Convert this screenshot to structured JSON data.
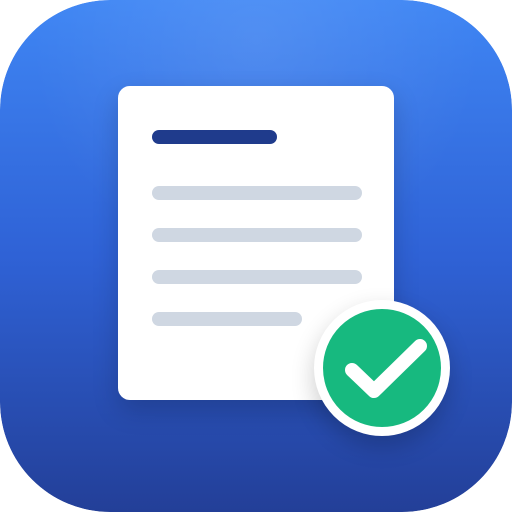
{
  "icon": {
    "name": "document-check-app-icon",
    "colors": {
      "tile_gradient_top": "#3f86f4",
      "tile_gradient_bottom": "#233f98",
      "tile_edge": "#1f3f96",
      "document": "#ffffff",
      "title_bar": "#1f3b8c",
      "text_lines": "#cfd7e2",
      "badge": "#17b97f",
      "badge_ring": "#ffffff",
      "check": "#ffffff"
    },
    "document": {
      "icon": "document-icon",
      "line_count": 4
    },
    "badge": {
      "icon": "checkmark-icon",
      "status": "complete"
    }
  }
}
